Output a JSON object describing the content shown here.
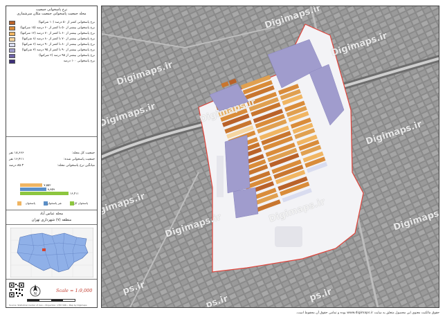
{
  "panel": {
    "title_line1": "نرخ پاسخوانی جمعیت",
    "title_line2": "محله جمعیت پاسخوانی جمعیت مکان سرشماری"
  },
  "legend": [
    {
      "color": "#b9622a",
      "text": "نرخ پاسخوانی کمتر از ۵۰ درصد (۱۰ شرکتها)"
    },
    {
      "color": "#d98c3a",
      "text": "نرخ پاسخوانی بیشتر از ۵۰ تا کمتر از ۶۰ درصد (۱۵ شرکتها)"
    },
    {
      "color": "#f0b562",
      "text": "نرخ پاسخوانی بیشتر از ۶۰ تا کمتر از ۷۰ درصد (۱۲ شرکتها)"
    },
    {
      "color": "#f6d5a0",
      "text": "نرخ پاسخوانی بیشتر از ۷۰ تا کمتر از ۸۰ درصد (۸ شرکتها)"
    },
    {
      "color": "#d9dcef",
      "text": "نرخ پاسخوانی بیشتر از ۸۰ تا کمتر از ۹۰ درصد (۶ شرکتها)"
    },
    {
      "color": "#a09ccd",
      "text": "نرخ پاسخوانی بیشتر از ۹۰ تا کمتر از ۹۵ درصد (۳ شرکتها)"
    },
    {
      "color": "#6f63a8",
      "text": "نرخ پاسخوانی بیشتر از ۹۵ درصد (۲ شرکتها)"
    },
    {
      "color": "#3d2f7a",
      "text": "نرخ پاسخوانی ۱۰۰ درصد"
    }
  ],
  "stats": [
    {
      "label": "جمعیت کل محله:",
      "value": "۱۸,۶۶۶ نفر"
    },
    {
      "label": "جمعیت پاسخوانی شده:",
      "value": "۱۶,۴۱۱ نفر"
    },
    {
      "label": "میانگین نرخ پاسخوانی محله:",
      "value": "۸۵.۳ درصد"
    }
  ],
  "chart_data": {
    "type": "bar",
    "categories": [
      "اقتصادی",
      "آموزشی",
      "کل"
    ],
    "series": [
      {
        "values": [
          7552,
          8859,
          16411
        ]
      }
    ],
    "value_labels": [
      "۷,۵۵۲",
      "۸,۸۵۹",
      "۱۶,۴۱۱"
    ],
    "colors": [
      "#f0b562",
      "#5b8fc7",
      "#8dc63f"
    ]
  },
  "categories_legend": [
    {
      "color": "#f0b562",
      "text": "پاسخوان"
    },
    {
      "color": "#5b8fc7",
      "text": "غیر پاسخوان"
    },
    {
      "color": "#8dc63f",
      "text": "پاسخوان کل"
    }
  ],
  "region": {
    "name": "محله عباس آباد",
    "district": "منطقه (۷) شهرداری تهران"
  },
  "scale": {
    "text": "Scale = 1:9,000"
  },
  "credits": "Source: Statistical Center of Iran • Projection: UTM 39N • Map by Digimaps",
  "watermarks": [
    "Digimaps.ir",
    "Digimaps.ir",
    "Digimaps.ir",
    "Digimaps.ir",
    "Digimaps.ir",
    "Digimaps.ir",
    "Digimaps.ir",
    "Digimaps.ir",
    "Digimaps.ir",
    "Digimaps.ir",
    "ps.ir",
    "ps.ir",
    "ps.ir"
  ],
  "footer": "حقوق مالکیت معنوی این محصول متعلق به سایت www.digimaps.ir بوده و تمامی حقوق آن محفوظ است."
}
